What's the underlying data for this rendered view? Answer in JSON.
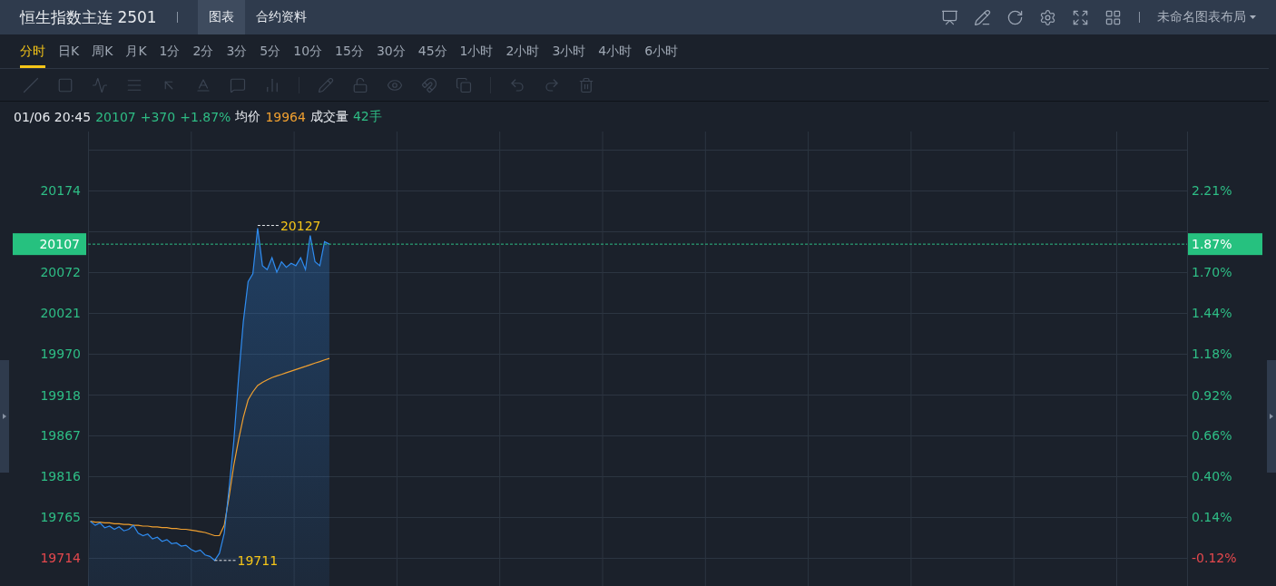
{
  "header": {
    "title": "恒生指数主连 2501",
    "tabs": [
      {
        "label": "图表",
        "selected": true
      },
      {
        "label": "合约资料",
        "selected": false
      }
    ],
    "layout_menu": "未命名图表布局"
  },
  "timeframes": [
    {
      "label": "分时",
      "selected": true
    },
    {
      "label": "日K",
      "selected": false
    },
    {
      "label": "周K",
      "selected": false
    },
    {
      "label": "月K",
      "selected": false
    },
    {
      "label": "1分",
      "selected": false
    },
    {
      "label": "2分",
      "selected": false
    },
    {
      "label": "3分",
      "selected": false
    },
    {
      "label": "5分",
      "selected": false
    },
    {
      "label": "10分",
      "selected": false
    },
    {
      "label": "15分",
      "selected": false
    },
    {
      "label": "30分",
      "selected": false
    },
    {
      "label": "45分",
      "selected": false
    },
    {
      "label": "1小时",
      "selected": false
    },
    {
      "label": "2小时",
      "selected": false
    },
    {
      "label": "3小时",
      "selected": false
    },
    {
      "label": "4小时",
      "selected": false
    },
    {
      "label": "6小时",
      "selected": false
    }
  ],
  "quote": {
    "time": "01/06 20:45",
    "price": "20107",
    "change": "+370",
    "change_pct": "+1.87%",
    "avg_label": "均价",
    "avg": "19964",
    "volume_label": "成交量",
    "volume": "42手"
  },
  "chart": {
    "current_pct_tag": "1.87%",
    "high_label": "20127",
    "low_label": "19711",
    "right_axis": [
      {
        "label": "2.21%",
        "color": "#2ebd85"
      },
      {
        "label": "1.70%",
        "color": "#2ebd85"
      },
      {
        "label": "1.44%",
        "color": "#2ebd85"
      },
      {
        "label": "1.18%",
        "color": "#2ebd85"
      },
      {
        "label": "0.92%",
        "color": "#2ebd85"
      },
      {
        "label": "0.66%",
        "color": "#2ebd85"
      },
      {
        "label": "0.40%",
        "color": "#2ebd85"
      },
      {
        "label": "0.14%",
        "color": "#2ebd85"
      },
      {
        "label": "-0.12%",
        "color": "#e5484d"
      }
    ],
    "chart_data": {
      "type": "line",
      "ylim": [
        19679,
        20248
      ],
      "grid": true,
      "ref_lines": [
        {
          "axis": "y",
          "value": 20107,
          "label": "20107",
          "color": "#2ebd85"
        }
      ],
      "yticks": [
        {
          "value": 20174,
          "label": "20174"
        },
        {
          "value": 20072,
          "label": "20072"
        },
        {
          "value": 20021,
          "label": "20021"
        },
        {
          "value": 19970,
          "label": "19970"
        },
        {
          "value": 19918,
          "label": "19918"
        },
        {
          "value": 19867,
          "label": "19867"
        },
        {
          "value": 19816,
          "label": "19816"
        },
        {
          "value": 19765,
          "label": "19765"
        },
        {
          "value": 19714,
          "label": "19714"
        }
      ],
      "categories": [
        null,
        null,
        null,
        null,
        null,
        null,
        null,
        null,
        null,
        null,
        null,
        null,
        null,
        null,
        null,
        null,
        null,
        null,
        null,
        null,
        null,
        null,
        null,
        null,
        null,
        null,
        null,
        null,
        null,
        null,
        null,
        null,
        null,
        null,
        null,
        null,
        null,
        null,
        null,
        null,
        null,
        null,
        null,
        null,
        null,
        null,
        null,
        null,
        null,
        null,
        null,
        null,
        null,
        null,
        null,
        null,
        null,
        null,
        null,
        null,
        null,
        null,
        null,
        null,
        null,
        null,
        null,
        null,
        null,
        null,
        null,
        null,
        null,
        null,
        null,
        null,
        null,
        null,
        null,
        null,
        null,
        null,
        null,
        null,
        null,
        null,
        null,
        null,
        null,
        null,
        null,
        null,
        null,
        null,
        null,
        null,
        null,
        null,
        null,
        null,
        null,
        null,
        null,
        null,
        null,
        null,
        null,
        null,
        null,
        null,
        null,
        null,
        null,
        null,
        null,
        null,
        null,
        null,
        null,
        null,
        null,
        null,
        null,
        null,
        null,
        null,
        null,
        null,
        null,
        null,
        null,
        null,
        null,
        null,
        null,
        null,
        null,
        null,
        null,
        null,
        null,
        null,
        null,
        null,
        null,
        null,
        null,
        null,
        null,
        null,
        null,
        null,
        null,
        null,
        null,
        null,
        null,
        null,
        null,
        null,
        null,
        null,
        null,
        null,
        null,
        null,
        null,
        null,
        null,
        null,
        null,
        null,
        null,
        null,
        null,
        null,
        null,
        null,
        null,
        null,
        null,
        null,
        null,
        null,
        null,
        null,
        null,
        null,
        null,
        null,
        null,
        null,
        null,
        null,
        null,
        null,
        null,
        null,
        null,
        null,
        null,
        null,
        null,
        null,
        null,
        null,
        null,
        null,
        null,
        null,
        null,
        null,
        null,
        null,
        null,
        null,
        null,
        null,
        null,
        null,
        null,
        null,
        null,
        null,
        null,
        null,
        null,
        null,
        null,
        null
      ],
      "series": [
        {
          "color": "#2f8cf0",
          "values": [
            19760,
            19755,
            19758,
            19752,
            19754,
            19750,
            19753,
            19748,
            19750,
            19755,
            19745,
            19742,
            19744,
            19738,
            19740,
            19735,
            19737,
            19732,
            19733,
            19729,
            19730,
            19725,
            19722,
            19724,
            19718,
            19716,
            19711,
            19720,
            19745,
            19800,
            19860,
            19940,
            20010,
            20060,
            20070,
            20127,
            20080,
            20075,
            20090,
            20072,
            20085,
            20078,
            20083,
            20080,
            20090,
            20075,
            20118,
            20085,
            20080,
            20110,
            20107,
            null,
            null,
            null,
            null,
            null,
            null,
            null,
            null,
            null,
            null,
            null,
            null,
            null,
            null,
            null,
            null,
            null,
            null,
            null,
            null,
            null,
            null,
            null,
            null,
            null,
            null,
            null,
            null,
            null,
            null,
            null,
            null,
            null,
            null,
            null,
            null,
            null,
            null,
            null,
            null,
            null,
            null,
            null,
            null,
            null,
            null,
            null,
            null,
            null,
            null,
            null,
            null,
            null,
            null,
            null,
            null,
            null,
            null,
            null,
            null,
            null,
            null,
            null,
            null,
            null,
            null,
            null,
            null,
            null,
            null,
            null,
            null,
            null,
            null,
            null,
            null,
            null,
            null,
            null,
            null,
            null,
            null,
            null,
            null,
            null,
            null,
            null,
            null,
            null,
            null,
            null,
            null,
            null,
            null,
            null,
            null,
            null,
            null,
            null,
            null,
            null,
            null,
            null,
            null,
            null,
            null,
            null,
            null,
            null,
            null,
            null,
            null,
            null,
            null,
            null,
            null,
            null,
            null,
            null,
            null,
            null,
            null,
            null,
            null,
            null,
            null,
            null,
            null,
            null,
            null,
            null,
            null,
            null,
            null,
            null,
            null,
            null,
            null,
            null,
            null,
            null,
            null,
            null,
            null,
            null,
            null,
            null,
            null,
            null,
            null,
            null,
            null,
            null,
            null,
            null,
            null,
            null,
            null,
            null,
            null,
            null,
            null,
            null,
            null,
            null,
            null,
            null,
            null,
            null,
            null,
            null,
            null,
            null,
            null,
            null,
            null,
            null,
            null,
            null
          ]
        },
        {
          "color": "#f0a030",
          "values": [
            19760,
            19759,
            19759,
            19758,
            19758,
            19757,
            19757,
            19756,
            19756,
            19755,
            19755,
            19754,
            19754,
            19753,
            19753,
            19752,
            19752,
            19751,
            19751,
            19750,
            19750,
            19749,
            19748,
            19747,
            19746,
            19744,
            19742,
            19742,
            19755,
            19790,
            19830,
            19862,
            19890,
            19912,
            19922,
            19930,
            19934,
            19937,
            19940,
            19942,
            19944,
            19946,
            19948,
            19950,
            19952,
            19954,
            19956,
            19958,
            19960,
            19962,
            19964,
            null,
            null,
            null,
            null,
            null,
            null,
            null,
            null,
            null,
            null,
            null,
            null,
            null,
            null,
            null,
            null,
            null,
            null,
            null,
            null,
            null,
            null,
            null,
            null,
            null,
            null,
            null,
            null,
            null,
            null,
            null,
            null,
            null,
            null,
            null,
            null,
            null,
            null,
            null,
            null,
            null,
            null,
            null,
            null,
            null,
            null,
            null,
            null,
            null,
            null,
            null,
            null,
            null,
            null,
            null,
            null,
            null,
            null,
            null,
            null,
            null,
            null,
            null,
            null,
            null,
            null,
            null,
            null,
            null,
            null,
            null,
            null,
            null,
            null,
            null,
            null,
            null,
            null,
            null,
            null,
            null,
            null,
            null,
            null,
            null,
            null,
            null,
            null,
            null,
            null,
            null,
            null,
            null,
            null,
            null,
            null,
            null,
            null,
            null,
            null,
            null,
            null,
            null,
            null,
            null,
            null,
            null,
            null,
            null,
            null,
            null,
            null,
            null,
            null,
            null,
            null,
            null,
            null,
            null,
            null,
            null,
            null,
            null,
            null,
            null,
            null,
            null,
            null,
            null,
            null,
            null,
            null,
            null,
            null,
            null,
            null,
            null,
            null,
            null,
            null,
            null,
            null,
            null,
            null,
            null,
            null,
            null,
            null,
            null,
            null,
            null,
            null,
            null,
            null,
            null,
            null,
            null,
            null,
            null,
            null,
            null,
            null,
            null,
            null,
            null,
            null,
            null,
            null,
            null,
            null,
            null,
            null,
            null,
            null,
            null,
            null,
            null,
            null,
            null
          ]
        }
      ]
    }
  }
}
